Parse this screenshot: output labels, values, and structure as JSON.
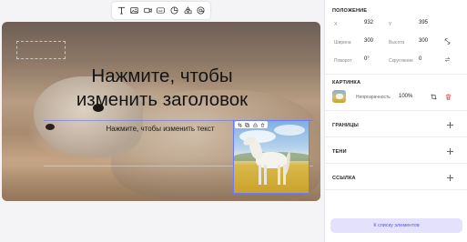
{
  "toolbar": {
    "tools": [
      {
        "icon": "text-icon"
      },
      {
        "icon": "image-icon"
      },
      {
        "icon": "video-icon"
      },
      {
        "icon": "gif-icon"
      },
      {
        "icon": "sticker-icon"
      },
      {
        "icon": "shapes-icon"
      },
      {
        "icon": "email-icon"
      }
    ]
  },
  "canvas": {
    "title_line1": "Нажмите, чтобы",
    "title_line2": "изменить заголовок",
    "subtitle": "Нажмите, чтобы изменить текст"
  },
  "panel": {
    "position": {
      "title": "ПОЛОЖЕНИЕ",
      "x_label": "X",
      "x_value": "932",
      "y_label": "Y",
      "y_value": "395",
      "width_label": "Ширина",
      "width_value": "300",
      "height_label": "Высота",
      "height_value": "300",
      "rotate_label": "Поворот",
      "rotate_value": "0°",
      "radius_label": "Скругление",
      "radius_value": "0"
    },
    "image": {
      "title": "КАРТИНКА",
      "opacity_label": "Непрозрачность",
      "opacity_value": "100%"
    },
    "sections": {
      "borders": "ГРАНИЦЫ",
      "shadows": "ТЕНИ",
      "link": "ССЫЛКА"
    },
    "back_button": "К списку элементов"
  },
  "colors": {
    "accent": "#5b55d9",
    "accent_bg": "#e3e1fb",
    "delete": "#e5484d",
    "selection": "#6b7bff"
  }
}
